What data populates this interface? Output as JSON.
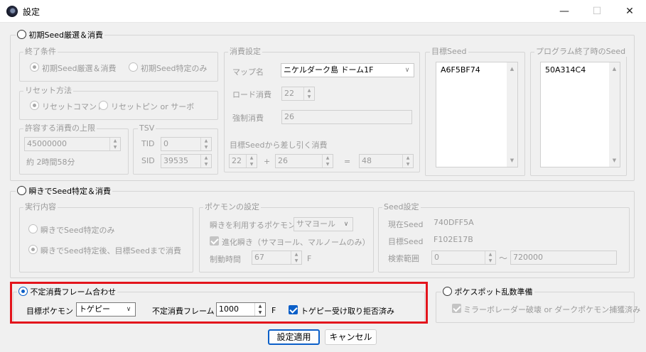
{
  "window": {
    "title": "設定",
    "minimize_glyph": "—",
    "maximize_glyph": "☐",
    "close_glyph": "✕"
  },
  "section1": {
    "radio_label": "初期Seed厳選＆消費",
    "end_cond": {
      "legend": "終了条件",
      "opt1": "初期Seed厳選＆消費",
      "opt2": "初期Seed特定のみ"
    },
    "reset": {
      "legend": "リセット方法",
      "opt1": "リセットコマンド",
      "opt2": "リセットピン or サーボ"
    },
    "limit": {
      "legend": "許容する消費の上限",
      "value": "45000000",
      "note": "約 2時間58分"
    },
    "tsv": {
      "legend": "TSV",
      "tid_label": "TID",
      "tid_value": "0",
      "sid_label": "SID",
      "sid_value": "39535"
    },
    "consume": {
      "legend": "消費設定",
      "map_label": "マップ名",
      "map_value": "ニケルダーク島 ドーム1F",
      "load_label": "ロード消費",
      "load_value": "22",
      "force_label": "強制消費",
      "force_value": "26",
      "sub_label": "目標Seedから差し引く消費",
      "sub_a": "22",
      "plus": "+",
      "sub_b": "26",
      "equals": "=",
      "sub_result": "48"
    },
    "target_seed": {
      "legend": "目標Seed",
      "value": "A6F5BF74"
    },
    "end_seed": {
      "legend": "プログラム終了時のSeed",
      "value": "50A314C4"
    }
  },
  "section2": {
    "radio_label": "瞬きでSeed特定＆消費",
    "mode": {
      "legend": "実行内容",
      "opt1": "瞬きでSeed特定のみ",
      "opt2": "瞬きでSeed特定後、目標Seedまで消費"
    },
    "pokemon": {
      "legend": "ポケモンの設定",
      "blink_label": "瞬きを利用するポケモン",
      "blink_value": "サマヨール",
      "evo_label": "進化瞬き（サマヨール、マルノームのみ）",
      "time_label": "制動時間",
      "time_value": "67",
      "time_unit": "F"
    },
    "seed": {
      "legend": "Seed設定",
      "current_label": "現在Seed",
      "current_value": "740DFF5A",
      "target_label": "目標Seed",
      "target_value": "F102E17B",
      "range_label": "検索範囲",
      "range_from": "0",
      "range_tilde": "〜",
      "range_to": "720000"
    }
  },
  "section3": {
    "radio_label": "不定消費フレーム合わせ",
    "target_label": "目標ポケモン",
    "target_value": "トゲピー",
    "frame_label": "不定消費フレーム",
    "frame_value": "1000",
    "frame_unit": "F",
    "toge_label": "トゲピー受け取り拒否済み"
  },
  "section4": {
    "radio_label": "ポケスポット乱数準備",
    "check_label": "ミラーボレーダー破壊 or ダークポケモン捕獲済み"
  },
  "buttons": {
    "apply": "設定適用",
    "cancel": "キャンセル"
  },
  "colors": {
    "highlight": "#e3141c",
    "accent": "#0b5fc8"
  }
}
